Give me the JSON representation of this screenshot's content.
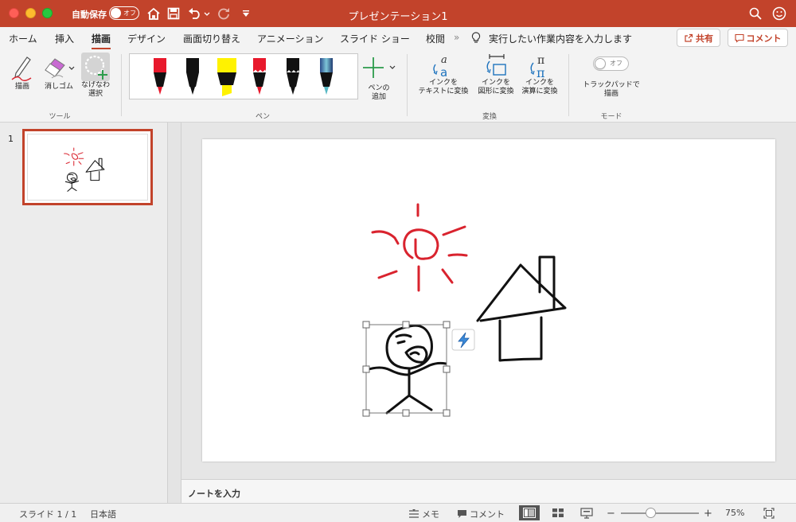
{
  "titlebar": {
    "autosave_label": "自動保存",
    "autosave_state": "オフ",
    "document_title": "プレゼンテーション1"
  },
  "tabs": [
    {
      "label": "ホーム"
    },
    {
      "label": "挿入"
    },
    {
      "label": "描画",
      "active": true
    },
    {
      "label": "デザイン"
    },
    {
      "label": "画面切り替え"
    },
    {
      "label": "アニメーション"
    },
    {
      "label": "スライド ショー"
    },
    {
      "label": "校閲"
    }
  ],
  "tell_me": "実行したい作業内容を入力します",
  "share_label": "共有",
  "comment_label": "コメント",
  "ribbon": {
    "tools": {
      "draw_label": "描画",
      "eraser_label": "消しゴム",
      "lasso_label_1": "なげなわ",
      "lasso_label_2": "選択",
      "group_label": "ツール"
    },
    "pens": {
      "group_label": "ペン",
      "add_pen_label_1": "ペンの",
      "add_pen_label_2": "追加",
      "colors": [
        "#e8192c",
        "#111111",
        "#fff200",
        "#e8192c",
        "#111111",
        "#3a6fa8"
      ]
    },
    "convert": {
      "group_label": "変換",
      "ink_to_text_1": "インクを",
      "ink_to_text_2": "テキストに変換",
      "ink_to_shape_1": "インクを",
      "ink_to_shape_2": "図形に変換",
      "ink_to_math_1": "インクを",
      "ink_to_math_2": "演算に変換"
    },
    "mode": {
      "group_label": "モード",
      "toggle_state": "オフ",
      "trackpad_label_1": "トラックパッドで",
      "trackpad_label_2": "描画"
    }
  },
  "thumbnails": [
    {
      "number": "1"
    }
  ],
  "notes_placeholder": "ノートを入力",
  "statusbar": {
    "slide_info": "スライド 1 / 1",
    "language": "日本語",
    "notes_label": "メモ",
    "comments_label": "コメント",
    "zoom_minus": "−",
    "zoom_plus": "+",
    "zoom_level": "75%"
  },
  "colors": {
    "accent": "#c2432b",
    "ink_red": "#d9232e",
    "ink_black": "#111111"
  }
}
